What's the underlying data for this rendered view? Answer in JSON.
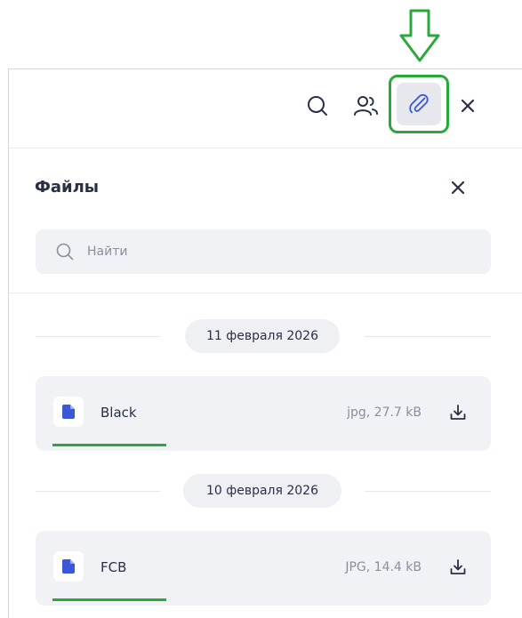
{
  "toolbar": {
    "icons": [
      "search-icon",
      "users-icon",
      "paperclip-icon",
      "close-icon"
    ],
    "highlight_color": "#2aa93b"
  },
  "files_panel": {
    "title": "Файлы",
    "close_icon": "close-icon",
    "search": {
      "placeholder": "Найти",
      "value": ""
    },
    "groups": [
      {
        "date": "11 февраля 2026",
        "files": [
          {
            "name": "Black",
            "meta": "jpg, 27.7 kB",
            "icon": "file-icon",
            "action_icon": "download-icon"
          }
        ]
      },
      {
        "date": "10 февраля 2026",
        "files": [
          {
            "name": "FCB",
            "meta": "JPG, 14.4 kB",
            "icon": "file-icon",
            "action_icon": "download-icon"
          }
        ]
      }
    ]
  },
  "colors": {
    "accent_icon": "#3b57d6",
    "annotation_green": "#2aa93b",
    "card_bg": "#f1f2f5",
    "text_dark": "#2a2f45",
    "text_muted": "#8a8f9c"
  }
}
